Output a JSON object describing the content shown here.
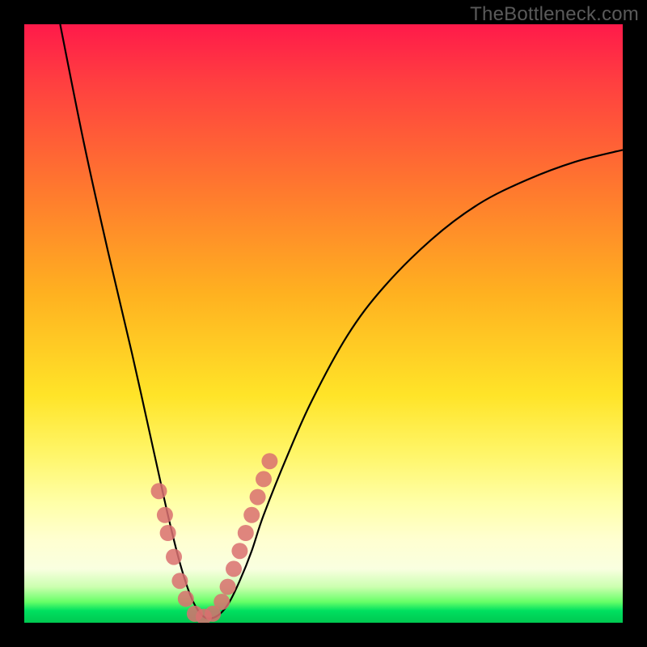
{
  "watermark": "TheBottleneck.com",
  "colors": {
    "frame": "#000000",
    "curve_stroke": "#000000",
    "marker_fill": "#d97070",
    "gradient_top": "#ff1a4a",
    "gradient_bottom": "#00c850"
  },
  "chart_data": {
    "type": "line",
    "title": "",
    "xlabel": "",
    "ylabel": "",
    "xlim": [
      0,
      100
    ],
    "ylim": [
      0,
      100
    ],
    "note": "Bottleneck-style V curve; y≈0 near x≈30 (optimal), rising steeply on both sides. Values are percentages estimated from pixel positions.",
    "series": [
      {
        "name": "bottleneck-curve",
        "x": [
          6,
          10,
          14,
          18,
          22,
          24,
          26,
          28,
          30,
          32,
          34,
          36,
          38,
          40,
          44,
          48,
          54,
          60,
          68,
          76,
          84,
          92,
          100
        ],
        "y": [
          100,
          80,
          62,
          45,
          27,
          18,
          10,
          4,
          1,
          1,
          3,
          7,
          12,
          18,
          28,
          37,
          48,
          56,
          64,
          70,
          74,
          77,
          79
        ]
      }
    ],
    "markers": {
      "name": "highlighted-points",
      "note": "Salmon dots clustered along both flanks of the V just above the minimum, across the pale-yellow/green band.",
      "x": [
        22.5,
        23.5,
        24.0,
        25.0,
        26.0,
        27.0,
        28.5,
        30.0,
        31.5,
        33.0,
        34.0,
        35.0,
        36.0,
        37.0,
        38.0,
        39.0,
        40.0,
        41.0
      ],
      "y": [
        22.0,
        18.0,
        15.0,
        11.0,
        7.0,
        4.0,
        1.5,
        1.0,
        1.5,
        3.5,
        6.0,
        9.0,
        12.0,
        15.0,
        18.0,
        21.0,
        24.0,
        27.0
      ]
    }
  }
}
